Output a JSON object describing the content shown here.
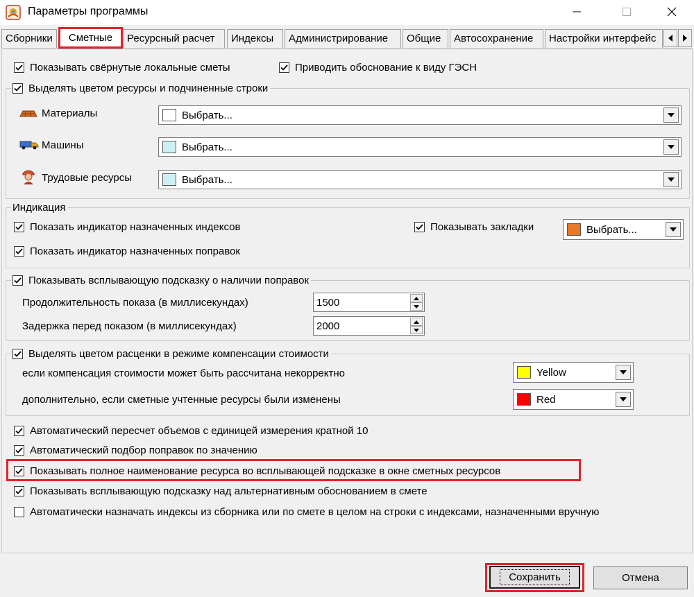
{
  "window": {
    "title": "Параметры программы",
    "controls": {
      "minimize": "minimize-icon",
      "maximize": "maximize-icon",
      "close": "close-icon"
    }
  },
  "tabs": [
    {
      "label": "Сборники"
    },
    {
      "label": "Сметные",
      "active": true
    },
    {
      "label": "Ресурсный расчет"
    },
    {
      "label": "Индексы"
    },
    {
      "label": "Администрирование"
    },
    {
      "label": "Общие"
    },
    {
      "label": "Автосохранение"
    },
    {
      "label": "Настройки интерфейс"
    }
  ],
  "top_options": {
    "show_collapsed": {
      "label": "Показывать свёрнутые локальные сметы",
      "checked": true
    },
    "gesn": {
      "label": "Приводить обоснование к виду ГЭСН",
      "checked": true
    }
  },
  "resources_group": {
    "title": "Выделять цветом ресурсы и подчиненные строки",
    "checked": true,
    "rows": [
      {
        "label": "Материалы",
        "icon": "bricks-icon",
        "value": "Выбрать...",
        "color": "#ffffff"
      },
      {
        "label": "Машины",
        "icon": "truck-icon",
        "value": "Выбрать...",
        "color": "#ccf0f4"
      },
      {
        "label": "Трудовые ресурсы",
        "icon": "worker-icon",
        "value": "Выбрать...",
        "color": "#ccf0f4"
      }
    ]
  },
  "indication_group": {
    "title": "Индикация",
    "indexes": {
      "label": "Показать индикатор назначенных индексов",
      "checked": true
    },
    "corrections": {
      "label": "Показать индикатор назначенных поправок",
      "checked": true
    },
    "bookmarks": {
      "label": "Показывать закладки",
      "checked": true,
      "value": "Выбрать...",
      "color": "#e8782a"
    }
  },
  "tooltip_group": {
    "title": "Показывать всплывающую подсказку о наличии поправок",
    "checked": true,
    "duration": {
      "label": "Продолжительность показа (в миллисекундах)",
      "value": "1500"
    },
    "delay": {
      "label": "Задержка перед показом (в миллисекундах)",
      "value": "2000"
    }
  },
  "compensation_group": {
    "title": "Выделять цветом расценки в режиме компенсации стоимости",
    "checked": true,
    "incorrect": {
      "label": "если компенсация стоимости может быть рассчитана некорректно",
      "value": "Yellow",
      "color": "#ffff00"
    },
    "changed": {
      "label": "дополнительно, если сметные учтенные ресурсы были изменены",
      "value": "Red",
      "color": "#ff0000"
    }
  },
  "bottom_options": [
    {
      "label": "Автоматический пересчет объемов с единицей измерения кратной 10",
      "checked": true
    },
    {
      "label": "Автоматический подбор поправок по значению",
      "checked": true
    },
    {
      "label": "Показывать полное наименование ресурса во всплывающей подсказке в окне сметных ресурсов",
      "checked": true
    },
    {
      "label": "Показывать всплывающую подсказку над альтернативным обоснованием в смете",
      "checked": true
    },
    {
      "label": "Автоматически назначать индексы из сборника или по смете в целом на строки с индексами, назначенными вручную",
      "checked": false
    }
  ],
  "buttons": {
    "save": "Сохранить",
    "cancel": "Отмена"
  },
  "highlight_color": "#e0242c"
}
